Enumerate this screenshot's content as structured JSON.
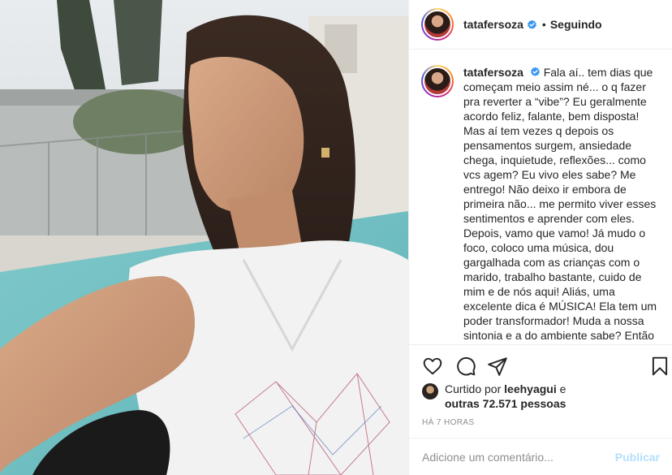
{
  "post": {
    "image_alt": "",
    "header": {
      "username": "tatafersoza",
      "separator": "•",
      "follow_status": "Seguindo",
      "more": "···"
    },
    "caption": {
      "username": "tatafersoza",
      "text": "Fala aí.. tem dias que começam meio assim né... o q fazer pra reverter a “vibe”? Eu geralmente acordo feliz, falante, bem disposta! Mas aí tem vezes q depois os pensamentos surgem, ansiedade chega, inquietude, reflexões... como vcs agem? Eu vivo eles sabe? Me entrego! Não deixo ir embora de primeira não... me permito viver esses sentimentos e aprender com eles. Depois, vamo que vamo! Já mudo o foco, coloco uma música, dou gargalhada com as crianças com o marido, trabalho bastante, cuido de mim e de nós aqui! Aliás, uma excelente dica é MÚSICA! Ela tem um poder transformador! Muda a nossa sintonia e a do ambiente sabe? Então"
    },
    "icons": {
      "like": "heart-icon",
      "comment": "comment-icon",
      "share": "share-icon",
      "save": "bookmark-icon",
      "verified": "verified-badge-icon"
    },
    "likes": {
      "prefix": "Curtido por",
      "user": "leehyagui",
      "conj": "e",
      "others": "outras 72.571 pessoas"
    },
    "time": "HÁ 7 HORAS",
    "comment_box": {
      "placeholder": "Adicione um comentário...",
      "publish_label": "Publicar"
    },
    "colors": {
      "verified_blue": "#3897f0",
      "publish_disabled": "#b2dffc",
      "muted": "#8e8e8e",
      "text": "#262626"
    }
  }
}
